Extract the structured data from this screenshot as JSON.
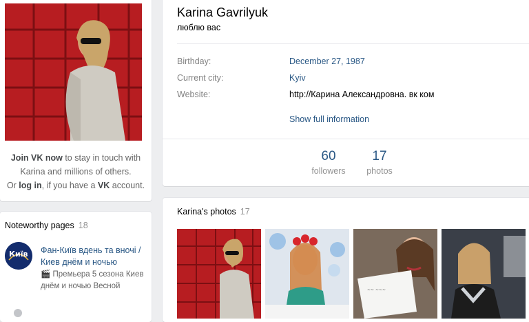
{
  "profile": {
    "name": "Karina Gavrilyuk",
    "status": "люблю вас",
    "info": [
      {
        "label": "Birthday:",
        "value": "December 27, 1987",
        "link": true
      },
      {
        "label": "Current city:",
        "value": "Kyiv",
        "link": true
      },
      {
        "label": "Website:",
        "value": "http://Карина Александровна. вк ком",
        "link": false
      }
    ],
    "show_full": "Show full information",
    "counters": [
      {
        "num": "60",
        "label": "followers"
      },
      {
        "num": "17",
        "label": "photos"
      }
    ]
  },
  "join": {
    "join_link": "Join VK now",
    "line1_rest": " to stay in touch with",
    "line2": "Karina and millions of others.",
    "line3_pre": "Or ",
    "login_link": "log in",
    "line3_mid": ", if you have a ",
    "vk": "VK",
    "line3_end": " account."
  },
  "noteworthy": {
    "title": "Noteworthy pages",
    "count": "18",
    "page_name": "Фан-Київ вдень та вночі / Киев днём и ночью",
    "page_desc": "🎬 Премьера 5 сезона Киев днём и ночью Весной",
    "logo_text": "Київ"
  },
  "photos": {
    "title": "Karina's photos",
    "count": "17"
  },
  "colors": {
    "background": "#edeef0",
    "link": "#2a5885",
    "muted": "#828282"
  }
}
